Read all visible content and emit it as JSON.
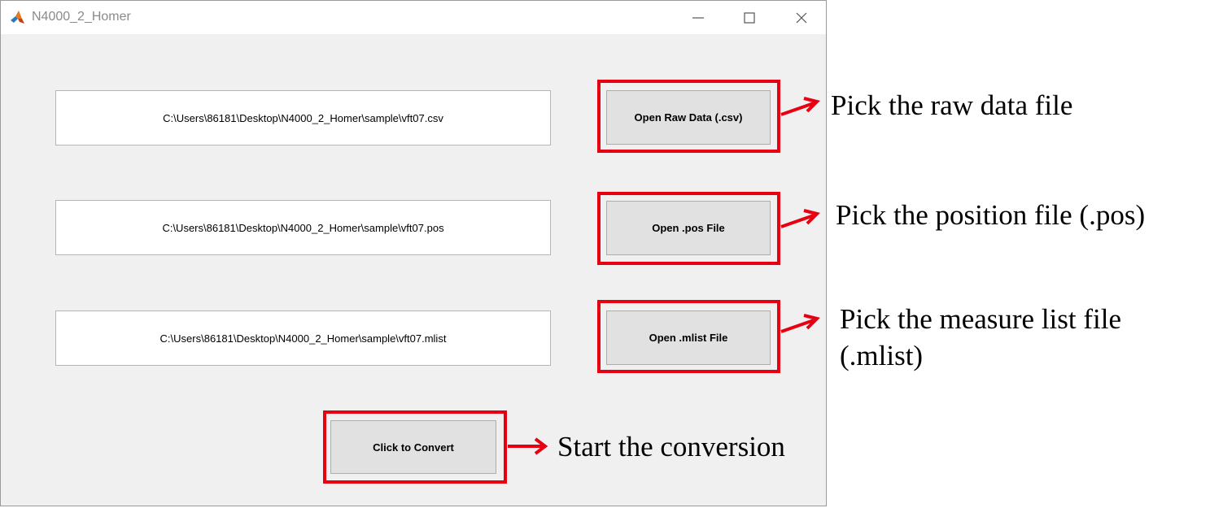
{
  "window": {
    "title": "N4000_2_Homer",
    "icon": "matlab-icon",
    "controls": [
      "minimize-icon",
      "maximize-icon",
      "close-icon"
    ]
  },
  "rows": [
    {
      "path": "C:\\Users\\86181\\Desktop\\N4000_2_Homer\\sample\\vft07.csv",
      "button": "Open Raw Data (.csv)"
    },
    {
      "path": "C:\\Users\\86181\\Desktop\\N4000_2_Homer\\sample\\vft07.pos",
      "button": "Open .pos File"
    },
    {
      "path": "C:\\Users\\86181\\Desktop\\N4000_2_Homer\\sample\\vft07.mlist",
      "button": "Open .mlist File"
    }
  ],
  "convert": {
    "button": "Click to Convert"
  },
  "annotations": {
    "raw": "Pick the raw data file",
    "pos": "Pick the position file (.pos)",
    "mlist_line1": "Pick the measure list file",
    "mlist_line2": "(.mlist)",
    "convert": "Start the conversion"
  },
  "colors": {
    "highlight": "#e60012",
    "window_bg": "#f0f0f0",
    "button_bg": "#e1e1e1"
  }
}
